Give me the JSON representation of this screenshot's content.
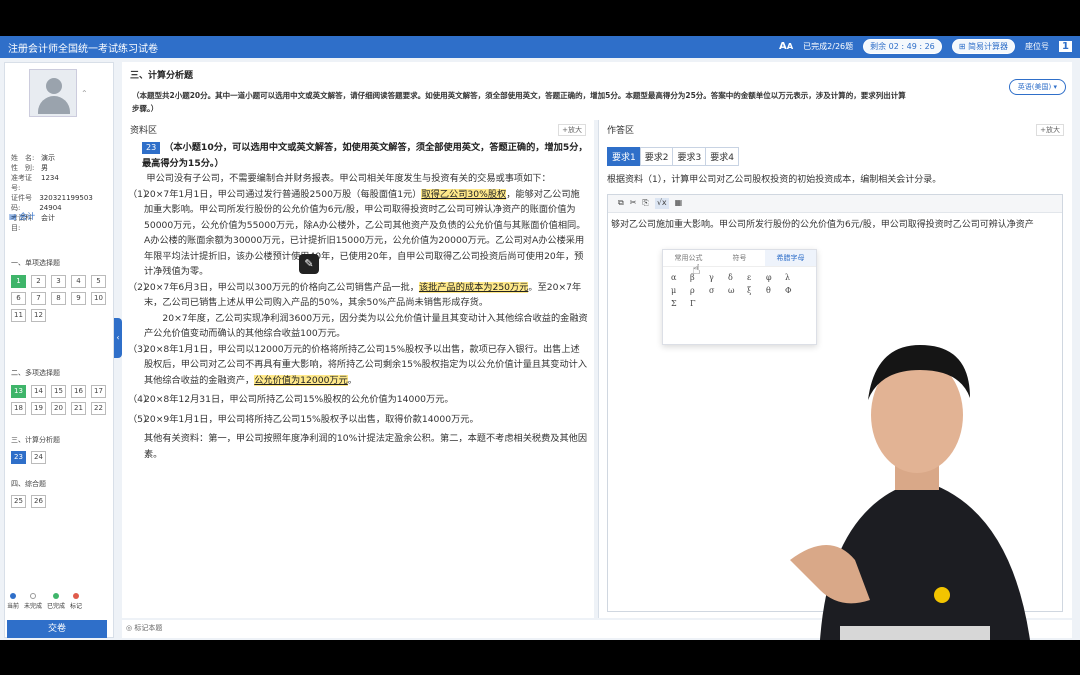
{
  "app": {
    "title": "注册会计师全国统一考试练习试卷",
    "progress": "已完成2/26题",
    "timer_label": "剩余",
    "timer": "02 : 49 : 26",
    "calculator": "简易计算器",
    "seat_label": "座位号",
    "seat": "1"
  },
  "candidate": {
    "fields": [
      {
        "k": "姓　名:",
        "v": "演示"
      },
      {
        "k": "性　别:",
        "v": "男"
      },
      {
        "k": "准考证号:",
        "v": "1234"
      },
      {
        "k": "证件号码:",
        "v": "320321199503 24904"
      },
      {
        "k": "考试科目:",
        "v": "会计"
      }
    ]
  },
  "nav": {
    "subject": "会计",
    "sections": [
      {
        "title": "一、单项选择题",
        "questions": [
          "1",
          "2",
          "3",
          "4",
          "5",
          "6",
          "7",
          "8",
          "9",
          "10",
          "11",
          "12"
        ]
      },
      {
        "title": "二、多项选择题",
        "questions": [
          "13",
          "14",
          "15",
          "16",
          "17",
          "18",
          "19",
          "20",
          "21",
          "22"
        ]
      },
      {
        "title": "三、计算分析题",
        "questions": [
          "23",
          "24"
        ]
      },
      {
        "title": "四、综合题",
        "questions": [
          "25",
          "26"
        ]
      }
    ],
    "legend": [
      "当前",
      "未完成",
      "已完成",
      "标记"
    ],
    "submit": "交卷"
  },
  "section": {
    "title": "三、计算分析题",
    "desc": "（本题型共2小题20分。其中一道小题可以选用中文或英文解答，请仔细阅读答题要求。如使用英文解答，须全部使用英文，答题正确的，增加5分。本题型最高得分为25分。答案中的金额单位以万元表示，涉及计算的，要求列出计算步骤。）",
    "lang": "英语(美国)"
  },
  "material": {
    "label": "资料区",
    "enlarge": "+放大",
    "qnum": "23",
    "intro_bold": "（本小题10分，可以选用中文或英文解答，如使用英文解答，须全部使用英文，答题正确的，增加5分，最高得分为15分。）",
    "p0": "甲公司没有子公司，不需要编制合并财务报表。甲公司相关年度发生与投资有关的交易或事项如下：",
    "i1_a": "20×7年1月1日，甲公司通过发行普通股2500万股（每股面值1元）",
    "i1_hl": "取得乙公司30%股权",
    "i1_b": "，能够对乙公司施加重大影响。甲公司所发行股份的公允价值为6元/股，甲公司取得投资时乙公司可辨认净资产的账面价值为50000万元，公允价值为55000万元，除A办公楼外，乙公司其他资产及负债的公允价值与其账面价值相同。A办公楼的账面余额为30000万元，已计提折旧15000万元，公允价值为20000万元。乙公司对A办公楼采用年限平均法计提折旧，该办公楼预计使用40年，已使用20年，自甲公司取得乙公司投资后尚可使用20年，预计净残值为零。",
    "i2_a": "20×7年6月3日，甲公司以300万元的价格向乙公司销售产品一批，",
    "i2_hl": "该批产品的成本为250万元",
    "i2_b": "。至20×7年末，乙公司已销售上述从甲公司购入产品的50%，其余50%产品尚未销售形成存货。",
    "p2": "20×7年度，乙公司实现净利润3600万元，因分类为以公允价值计量且其变动计入其他综合收益的金融资产公允价值变动而确认的其他综合收益100万元。",
    "i3_a": "20×8年1月1日，甲公司以12000万元的价格将所持乙公司15%股权予以出售，款项已存入银行。出售上述股权后，甲公司对乙公司不再具有重大影响，将所持乙公司剩余15%股权指定为以公允价值计量且其变动计入其他综合收益的金融资产，",
    "i3_hl": "公允价值为12000万元",
    "i3_b": "。",
    "i4": "20×8年12月31日，甲公司所持乙公司15%股权的公允价值为14000万元。",
    "i5": "20×9年1月1日，甲公司将所持乙公司15%股权予以出售，取得价款14000万元。",
    "other": "其他有关资料：第一，甲公司按照年度净利润的10%计提法定盈余公积。第二，本题不考虑相关税费及其他因素。",
    "item_nums": [
      "（1）",
      "（2）",
      "（3）",
      "（4）",
      "（5）"
    ]
  },
  "answer": {
    "label": "作答区",
    "enlarge": "+放大",
    "tabs": [
      "要求1",
      "要求2",
      "要求3",
      "要求4"
    ],
    "requirement": "根据资料（1），计算甲公司对乙公司股权投资的初始投资成本，编制相关会计分录。",
    "toolbar": [
      "⧉",
      "✂",
      "⎘",
      "√x",
      "▦"
    ],
    "text": "够对乙公司施加重大影响。甲公司所发行股份的公允价值为6元/股，甲公司取得投资时乙公司可辨认净资产",
    "popup_tabs": [
      "常用公式",
      "符号",
      "希腊字母"
    ],
    "greek": [
      "α",
      "β",
      "γ",
      "δ",
      "ε",
      "φ",
      "λ",
      "μ",
      "ρ",
      "σ",
      "ω",
      "ξ",
      "θ",
      "Φ",
      "Σ",
      "Γ"
    ]
  },
  "bottom": {
    "mark": "标记本题"
  },
  "colors": {
    "accent": "#2f6fc9",
    "done": "#3fb56a",
    "highlight": "#ffe98a"
  }
}
